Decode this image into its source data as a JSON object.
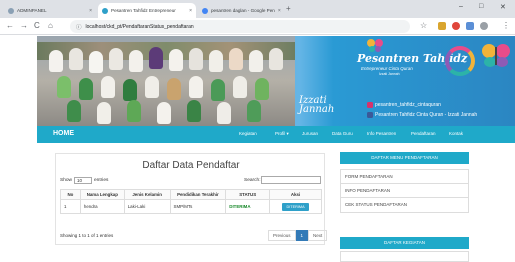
{
  "browser": {
    "tabs": [
      {
        "title": "ADMINPANEL",
        "close": "×"
      },
      {
        "title": "Pesantren Tahfidz Entrepreneur",
        "close": "×"
      },
      {
        "title": "pesantren daglan - Google Pen",
        "close": "×"
      }
    ],
    "new_tab": "+",
    "window_buttons": {
      "minimize": "–",
      "maximize": "□",
      "close": "✕"
    },
    "nav": {
      "back": "←",
      "forward": "→",
      "reload": "C",
      "home": "⌂"
    },
    "url": "localhost/ckd_pt/PendaftaranStatus_pendaftaran",
    "info_icon": "ⓘ",
    "star_icon": "☆",
    "menu_icon": "⋮"
  },
  "banner": {
    "brand_title": "Pesantren Tahfidz",
    "brand_subtitle": "Entrepreneur Cinta Quran",
    "brand_location": "Izzati Jannah",
    "izzati": "Izzati",
    "jannah": "Jannah",
    "instagram": "pesantren_tahfidz_cintaquran",
    "facebook": "Pesantren Tahfidz Cinta Quran - Izzati Jannah"
  },
  "nav": {
    "home": "HOME",
    "items": [
      "Kegiatan",
      "Profil ▾",
      "Jurusan",
      "Data Guru",
      "Info Pesantren",
      "Pendaftaran",
      "Kontak"
    ]
  },
  "main": {
    "title": "Daftar Data Pendaftar",
    "show_prefix": "Show",
    "show_value": "10",
    "show_suffix": "entries",
    "search_label": "Search:",
    "columns": [
      "No",
      "Nama Lengkap",
      "Jenis Kelamin",
      "Pendidikan Terakhir",
      "STATUS",
      "Aksi"
    ],
    "rows": [
      {
        "no": "1",
        "nama": "hendra",
        "jk": "Laki-Laki",
        "pendidikan": "SMP/MTs",
        "status": "DITERIMA",
        "aksi": "DITERIMA"
      }
    ],
    "info": "Showing 1 to 1 of 1 entries",
    "pager": {
      "previous": "Previous",
      "current": "1",
      "next": "Next"
    }
  },
  "sidebar": {
    "menu_title": "DAFTAR MENU PENDAFTARAN",
    "menu_items": [
      "FORM PENDAFTARAN",
      "INFO PENDAFTARAN",
      "CEK STATUS PENDAFTARAN"
    ],
    "kegiatan_title": "DAFTAR KEGIATAN"
  },
  "colors": {
    "accent": "#1fa9c9",
    "status_green": "#1a8a2c",
    "button_blue": "#2ea0c9"
  }
}
